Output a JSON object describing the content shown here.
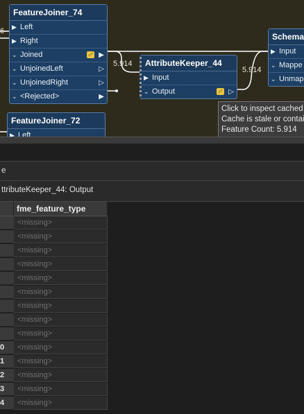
{
  "nodes": {
    "featurejoiner74": {
      "title": "FeatureJoiner_74",
      "ports": [
        {
          "label": "Left",
          "type": "input"
        },
        {
          "label": "Right",
          "type": "input"
        },
        {
          "label": "Joined",
          "type": "output"
        },
        {
          "label": "UnjoinedLeft",
          "type": "output"
        },
        {
          "label": "UnjoinedRight",
          "type": "output"
        },
        {
          "label": "<Rejected>",
          "type": "output"
        }
      ]
    },
    "attributekeeper44": {
      "title": "AttributeKeeper_44",
      "ports": [
        {
          "label": "Input",
          "type": "input"
        },
        {
          "label": "Output",
          "type": "output"
        }
      ]
    },
    "schemamapper": {
      "title": "SchemaM",
      "ports": [
        {
          "label": "Input",
          "type": "input"
        },
        {
          "label": "Mappe",
          "type": "output"
        },
        {
          "label": "Unmap",
          "type": "output"
        }
      ]
    },
    "featurejoiner72": {
      "title": "FeatureJoiner_72",
      "ports": [
        {
          "label": "Left",
          "type": "input"
        }
      ]
    }
  },
  "edge_counts": {
    "left_in": "6",
    "joined_to_keeper": "5.914",
    "keeper_to_schema": "5.914"
  },
  "tooltip": {
    "line1": "Click to inspect cached",
    "line2": "Cache is stale or contai",
    "line3": "Feature Count: 5.914"
  },
  "panel": {
    "name_partial": "e",
    "source_label": "ttributeKeeper_44: Output"
  },
  "table": {
    "columns": [
      "fme_feature_type"
    ],
    "row_labels": [
      "",
      "",
      "",
      "",
      "",
      "",
      "",
      "",
      "",
      "0",
      "1",
      "2",
      "3",
      "4"
    ],
    "cells": [
      "<missing>",
      "<missing>",
      "<missing>",
      "<missing>",
      "<missing>",
      "<missing>",
      "<missing>",
      "<missing>",
      "<missing>",
      "<missing>",
      "<missing>",
      "<missing>",
      "<missing>",
      "<missing>"
    ]
  },
  "colors": {
    "canvas_bg": "#2e2b1d",
    "node_bg": "#1d3f63",
    "node_border": "#5b7ea6",
    "cache_icon": "#e8c440"
  }
}
